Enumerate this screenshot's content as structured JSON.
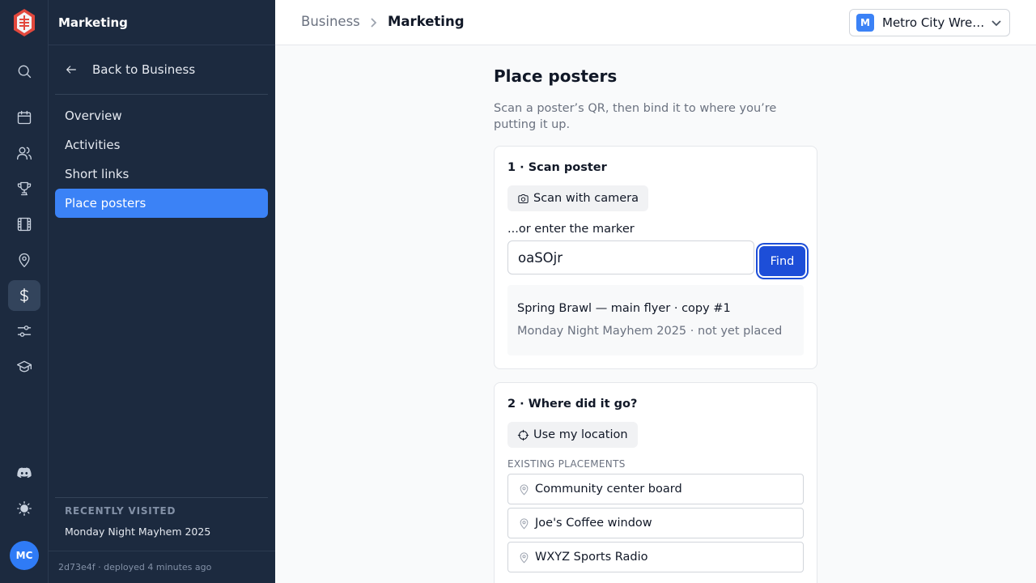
{
  "rail": {
    "icons": [
      "logo-icon",
      "search-icon",
      "calendar-icon",
      "users-icon",
      "trophy-icon",
      "film-icon",
      "map-pin-icon",
      "dollar-icon",
      "sliders-icon",
      "graduation-cap-icon",
      "discord-icon",
      "sun-icon"
    ],
    "avatar_initials": "MC"
  },
  "nav": {
    "title": "Marketing",
    "back_label": "Back to Business",
    "items": [
      "Overview",
      "Activities",
      "Short links",
      "Place posters"
    ],
    "active_item": "Place posters",
    "recent_title": "RECENTLY VISITED",
    "recent_item": "Monday Night Mayhem 2025",
    "footer": "2d73e4f · deployed 4 minutes ago"
  },
  "topbar": {
    "breadcrumb": [
      "Business",
      "Marketing"
    ],
    "org_badge": "M",
    "org_name": "Metro City Wrestling"
  },
  "main": {
    "title": "Place posters",
    "subtitle": "Scan a poster’s QR, then bind it to where you’re putting it up.",
    "step1": {
      "title": "1 · Scan poster",
      "scan_button": "Scan with camera",
      "marker_label": "...or enter the marker",
      "marker_value": "oaSOjr",
      "find_button": "Find",
      "result_title": "Spring Brawl — main flyer · copy #1",
      "result_sub": "Monday Night Mayhem 2025 · not yet placed"
    },
    "step2": {
      "title": "2 · Where did it go?",
      "location_button": "Use my location",
      "existing_label": "EXISTING PLACEMENTS",
      "placements": [
        "Community center board",
        "Joe's Coffee window",
        "WXYZ Sports Radio"
      ]
    }
  },
  "colors": {
    "sidebar_bg": "#1c2a3f",
    "accent": "#3b82f6",
    "find_button": "#1d4ed8"
  }
}
